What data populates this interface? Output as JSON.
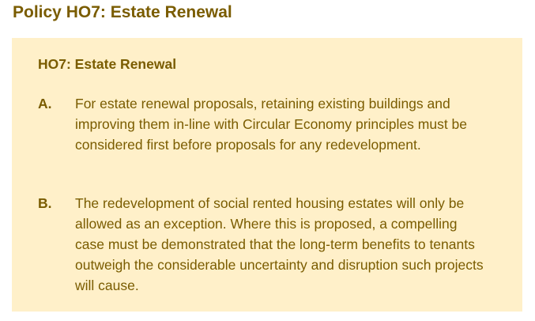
{
  "title": "Policy HO7: Estate Renewal",
  "box": {
    "heading": "HO7: Estate Renewal",
    "items": [
      {
        "label": "A.",
        "text": "For estate renewal proposals, retaining existing buildings and improving them in-line with Circular Economy principles must be considered first before proposals for any redevelopment."
      },
      {
        "label": "B.",
        "text": "The redevelopment of social rented housing estates will only be allowed as an exception. Where this is proposed, a compelling case must be demonstrated that the long-term benefits to tenants outweigh the considerable uncertainty and disruption such projects will cause."
      }
    ]
  }
}
